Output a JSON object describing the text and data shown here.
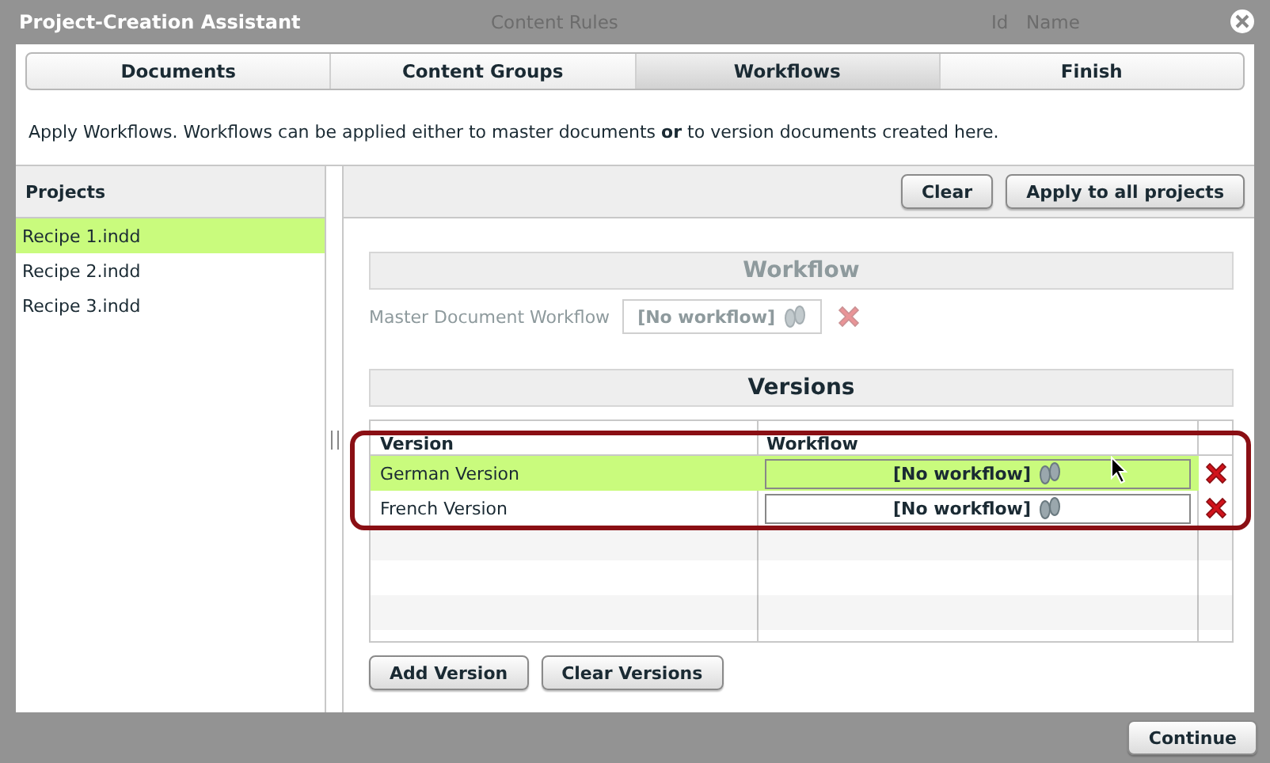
{
  "dialog": {
    "title": "Project-Creation Assistant"
  },
  "background": [
    "Content Rules",
    "Id",
    "Name"
  ],
  "steps": [
    {
      "label": "Documents",
      "selected": false
    },
    {
      "label": "Content Groups",
      "selected": false
    },
    {
      "label": "Workflows",
      "selected": true
    },
    {
      "label": "Finish",
      "selected": false
    }
  ],
  "description": "Apply Workflows. Workflows can be applied either to master documents **or** to version documents created here.",
  "projects": {
    "title": "Projects",
    "items": [
      {
        "label": "Recipe 1.indd",
        "selected": true
      },
      {
        "label": "Recipe 2.indd",
        "selected": false
      },
      {
        "label": "Recipe 3.indd",
        "selected": false
      }
    ]
  },
  "toolbar": {
    "buttons": [
      "Clear",
      "Apply to all projects"
    ]
  },
  "workflow": {
    "title": "Workflow",
    "disabled": true,
    "master_label": "Master Document Workflow",
    "master_value": "[No workflow]"
  },
  "versions": {
    "title": "Versions",
    "columns": [
      "Version",
      "Workflow"
    ],
    "rows": [
      {
        "name": "German Version",
        "workflow": "[No workflow]",
        "selected": true
      },
      {
        "name": "French Version",
        "workflow": "[No workflow]",
        "selected": false
      }
    ],
    "buttons": [
      "Add Version",
      "Clear Versions"
    ]
  },
  "footer": {
    "button": "Continue"
  }
}
